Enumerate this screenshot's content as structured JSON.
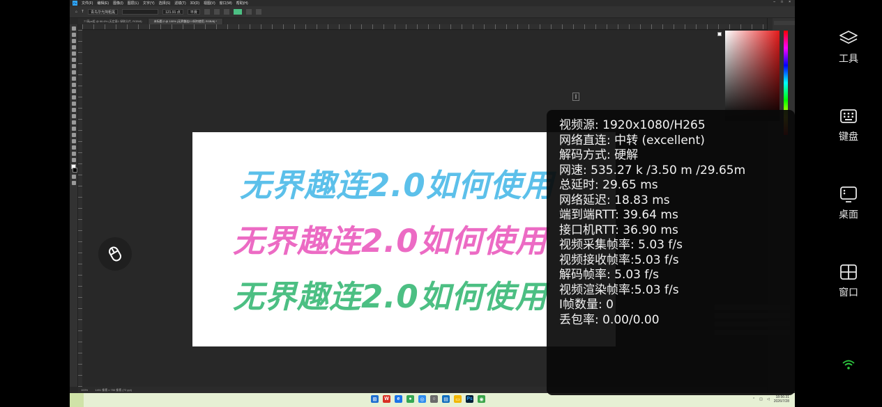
{
  "remote": {
    "menu_items": [
      "文件(F)",
      "编辑(E)",
      "图像(I)",
      "图层(L)",
      "文字(Y)",
      "选择(S)",
      "滤镜(T)",
      "3D(D)",
      "视图(V)",
      "窗口(W)",
      "帮助(H)"
    ],
    "tabs": [
      "77高ps组 @ 66.6% (无定基1 绿联分片, RGB/8)",
      "未标题-2 @ 100% (无界趣连2.0如何使用, RGB/8) *"
    ],
    "options": {
      "font_family": "青鸟华光简粗黑",
      "font_size": "121.91 点",
      "antialias": "平滑"
    },
    "artwork_lines": [
      "无界趣连2.0如何使用",
      "无界趣连2.0如何使用",
      "无界趣连2.0如何使用"
    ],
    "status": {
      "zoom": "100%",
      "doc_info": "1491 像素 x 755 像素 (72 ppi)"
    },
    "taskbar": {
      "time": "18:56:31",
      "date": "2026/7/28"
    },
    "colors": {
      "art_blue": "#5cc0ea",
      "art_pink": "#ec6bc4",
      "art_green": "#4cbf83"
    }
  },
  "stats": {
    "lines": [
      "视频源:  1920x1080/H265",
      "网络直连: 中转 (excellent)",
      "解码方式: 硬解",
      "网速: 535.27 k /3.50 m /29.65m",
      "总延时: 29.65 ms",
      "网络延迟: 18.83 ms",
      "端到端RTT: 39.64 ms",
      "接口机RTT: 36.90 ms",
      "视频采集帧率: 5.03 f/s",
      "视频接收帧率:5.03 f/s",
      "解码帧率: 5.03 f/s",
      "视频渲染帧率:5.03 f/s",
      "I帧数量: 0",
      "丢包率: 0.00/0.00"
    ]
  },
  "side": {
    "tools_label": "工具",
    "keyboard_label": "键盘",
    "desktop_label": "桌面",
    "window_label": "窗口",
    "wifi_color": "#2ecc40"
  }
}
